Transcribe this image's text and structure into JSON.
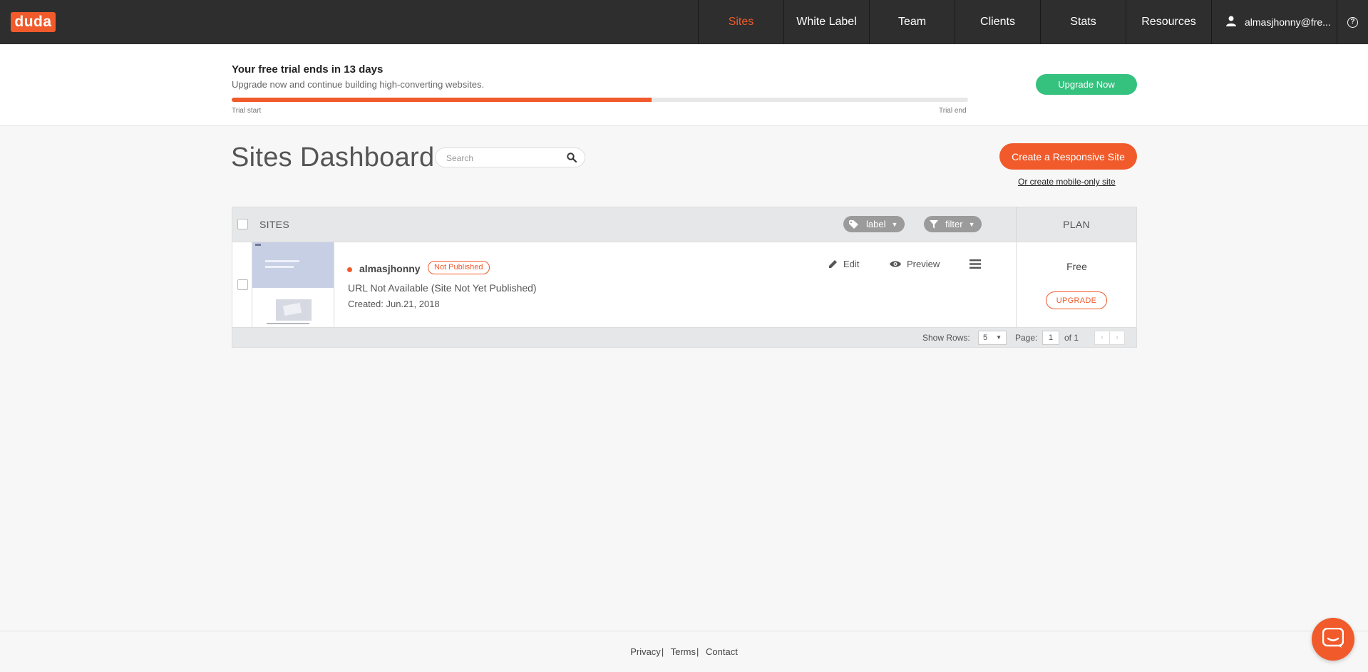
{
  "nav": {
    "logo": "duda",
    "items": [
      {
        "label": "Sites",
        "active": true
      },
      {
        "label": "White Label"
      },
      {
        "label": "Team"
      },
      {
        "label": "Clients"
      },
      {
        "label": "Stats"
      },
      {
        "label": "Resources"
      }
    ],
    "user": "almasjhonny@fre...",
    "help": "?"
  },
  "trial": {
    "title": "Your free trial ends in 13 days",
    "subtitle": "Upgrade now and continue building high-converting websites.",
    "progress_percent": 57,
    "start_label": "Trial start",
    "end_label": "Trial end",
    "upgrade_label": "Upgrade Now"
  },
  "dashboard": {
    "title": "Sites Dashboard",
    "search_placeholder": "Search",
    "create_label": "Create a Responsive Site",
    "mobile_link": "Or create mobile-only site"
  },
  "table": {
    "col_sites": "SITES",
    "label_pill": "label",
    "filter_pill": "filter",
    "col_plan": "PLAN",
    "rows": [
      {
        "name": "almasjhonny",
        "status": "Not Published",
        "url": "URL Not Available (Site Not Yet Published)",
        "created": "Created: Jun.21, 2018",
        "edit": "Edit",
        "preview": "Preview",
        "plan": "Free",
        "upgrade": "UPGRADE"
      }
    ],
    "footer": {
      "show_rows": "Show Rows:",
      "rows_value": "5",
      "page_label": "Page:",
      "page_value": "1",
      "of_label": "of 1",
      "prev": "‹",
      "next": "›"
    }
  },
  "footer": {
    "privacy": "Privacy",
    "terms": "Terms",
    "contact": "Contact",
    "sep": "|"
  },
  "colors": {
    "brand": "#f15a2b",
    "success": "#35c17e",
    "nav_bg": "#2e2e2e"
  }
}
